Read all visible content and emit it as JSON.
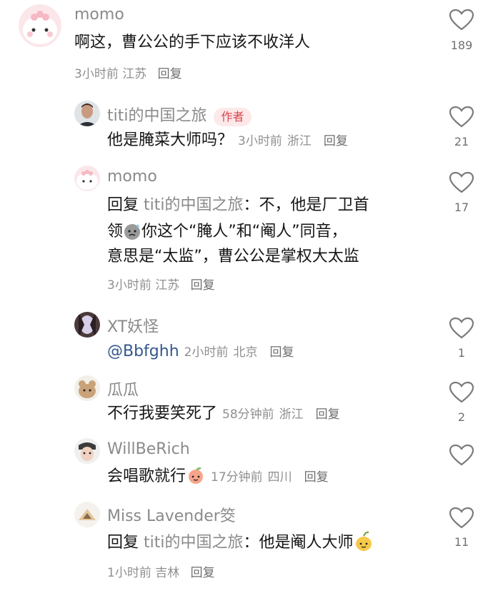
{
  "colors": {
    "text": "#161616",
    "meta": "#8f8f8f",
    "mention": "#33578c",
    "badge": "#d7434b"
  },
  "comments": [
    {
      "user": "momo",
      "text": "啊这，曹公公的手下应该不收洋人",
      "time": "3小时前",
      "location": "江苏",
      "reply": "回复",
      "likes": "189"
    },
    {
      "user": "titi的中国之旅",
      "badge": "作者",
      "text": "他是腌菜大师吗？",
      "time": "3小时前",
      "location": "浙江",
      "reply": "回复",
      "likes": "21"
    },
    {
      "user": "momo",
      "prefix": "回复",
      "target": "titi的中国之旅",
      "colon": "：",
      "line1": "不，他是厂卫首",
      "line2a": "领",
      "line2b": "你这个“腌人”和“阉人”同音，",
      "line3": "意思是“太监”，曹公公是掌权大太监",
      "time": "3小时前",
      "location": "江苏",
      "reply": "回复",
      "likes": "17"
    },
    {
      "user": "XT妖怪",
      "mention": "@Bbfghh",
      "time": "2小时前",
      "location": "北京",
      "reply": "回复",
      "likes": "1"
    },
    {
      "user": "瓜瓜",
      "text": "不行我要笑死了",
      "time": "58分钟前",
      "location": "浙江",
      "reply": "回复",
      "likes": "2"
    },
    {
      "user": "WillBeRich",
      "text": "会唱歌就行",
      "time": "17分钟前",
      "location": "四川",
      "reply": "回复",
      "likes": ""
    },
    {
      "user": "Miss Lavender筊",
      "prefix": "回复",
      "target": "titi的中国之旅",
      "colon": "：",
      "text": "他是阉人大师",
      "time": "1小时前",
      "location": "吉林",
      "reply": "回复",
      "likes": "11"
    }
  ],
  "icons": {
    "like": "heart-outline-icon"
  }
}
